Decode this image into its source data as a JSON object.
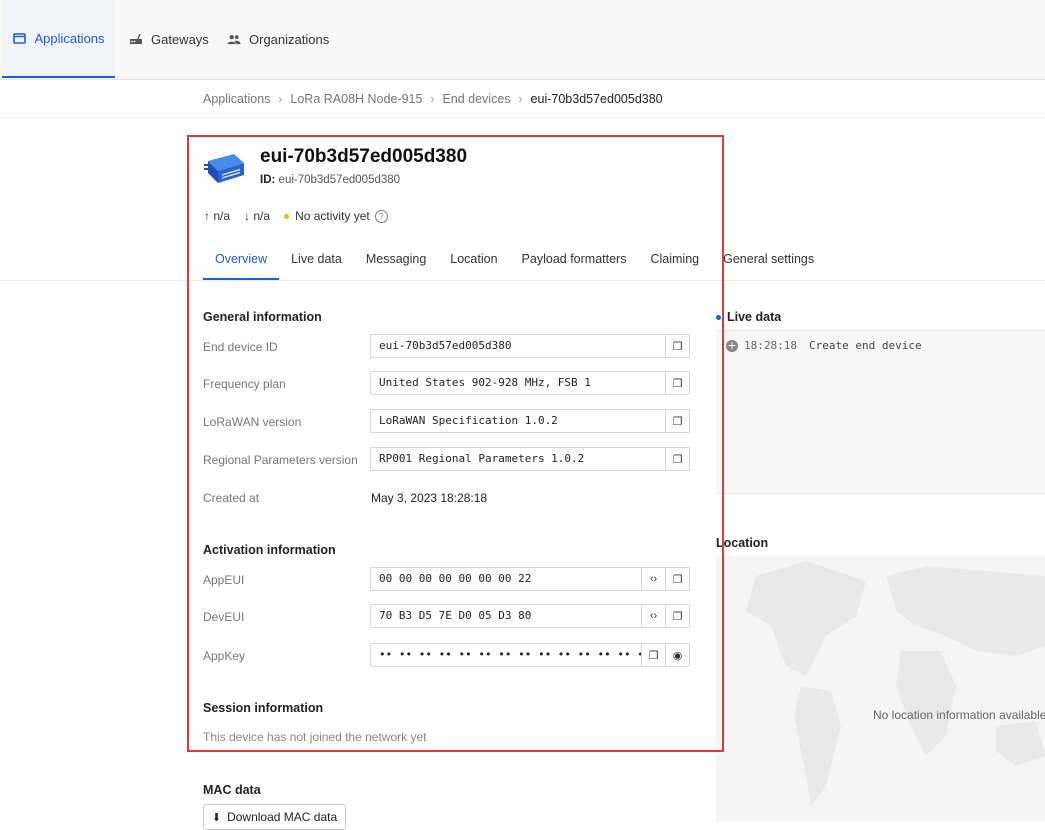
{
  "nav": {
    "items": [
      {
        "label": "Applications",
        "icon": "application-icon",
        "active": true
      },
      {
        "label": "Gateways",
        "icon": "gateway-icon",
        "active": false
      },
      {
        "label": "Organizations",
        "icon": "organization-icon",
        "active": false
      }
    ]
  },
  "breadcrumb": [
    "Applications",
    "LoRa RA08H Node-915",
    "End devices",
    "eui-70b3d57ed005d380"
  ],
  "device": {
    "title": "eui-70b3d57ed005d380",
    "id_label": "ID:",
    "id_value": "eui-70b3d57ed005d380",
    "uplink": "n/a",
    "downlink": "n/a",
    "activity": "No activity yet"
  },
  "tabs": [
    "Overview",
    "Live data",
    "Messaging",
    "Location",
    "Payload formatters",
    "Claiming",
    "General settings"
  ],
  "general": {
    "title": "General information",
    "end_device_id_label": "End device ID",
    "end_device_id": "eui-70b3d57ed005d380",
    "frequency_plan_label": "Frequency plan",
    "frequency_plan": "United States 902-928 MHz, FSB 1",
    "lorawan_version_label": "LoRaWAN version",
    "lorawan_version": "LoRaWAN Specification 1.0.2",
    "regional_label": "Regional Parameters version",
    "regional": "RP001 Regional Parameters 1.0.2",
    "created_label": "Created at",
    "created": "May 3, 2023 18:28:18"
  },
  "activation": {
    "title": "Activation information",
    "appeui_label": "AppEUI",
    "appeui": "00 00 00 00 00 00 00 22",
    "deveui_label": "DevEUI",
    "deveui": "70 B3 D5 7E D0 05 D3 80",
    "appkey_label": "AppKey",
    "appkey": "•• •• •• •• •• •• •• •• •• •• •• •• •• •• •• •• ••"
  },
  "session": {
    "title": "Session information",
    "text": "This device has not joined the network yet"
  },
  "mac": {
    "title": "MAC data",
    "download_label": "Download MAC data"
  },
  "live": {
    "title": "Live data",
    "time": "18:28:18",
    "event": "Create end device"
  },
  "location": {
    "title": "Location",
    "message": "No location information available"
  },
  "colors": {
    "accent": "#1c5fd8",
    "highlight": "#e03a3a",
    "activity_dot": "#f2b400"
  }
}
